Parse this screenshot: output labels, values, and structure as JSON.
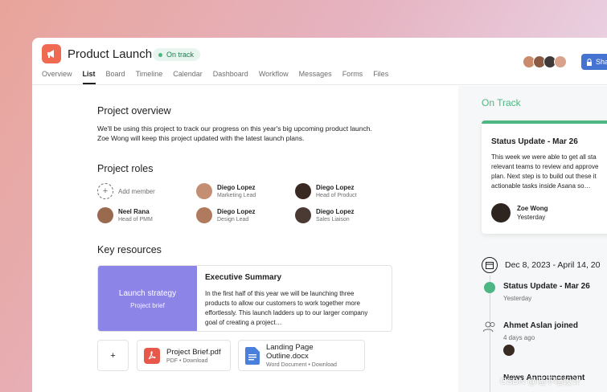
{
  "header": {
    "title": "Product Launch",
    "status": "On track",
    "share_label": "Sha",
    "tabs": [
      "Overview",
      "List",
      "Board",
      "Timeline",
      "Calendar",
      "Dashboard",
      "Workflow",
      "Messages",
      "Forms",
      "Files"
    ],
    "active_tab": "List"
  },
  "overview": {
    "title": "Project overview",
    "line1": "We'll be using this project to track our progress on this year's big upcoming product launch.",
    "line2": "Zoe Wong will keep this project updated with the latest launch plans."
  },
  "roles": {
    "title": "Project roles",
    "add_label": "Add member",
    "members": [
      {
        "name": "Diego Lopez",
        "role": "Marketing Lead"
      },
      {
        "name": "Diego Lopez",
        "role": "Head of Product"
      },
      {
        "name": "Neel Rana",
        "role": "Head of PMM"
      },
      {
        "name": "Diego Lopez",
        "role": "Design Lead"
      },
      {
        "name": "Diego Lopez",
        "role": "Sales Liaison"
      }
    ]
  },
  "resources": {
    "title": "Key resources",
    "thumb_title": "Launch strategy",
    "thumb_subtitle": "Project brief",
    "card_title": "Executive Summary",
    "card_line1": "In the first half of this year we will be launching three",
    "card_line2": "products to allow our customers to work together more",
    "card_line3": "effortlessly. This launch ladders up to our larger company",
    "card_line4": "goal of creating a project…",
    "add_symbol": "+",
    "files": [
      {
        "name": "Project Brief.pdf",
        "meta": "PDF • Download"
      },
      {
        "name": "Landing Page Outline.docx",
        "meta": "Word Document • Download"
      }
    ]
  },
  "sidebar": {
    "status_heading": "On Track",
    "update_title": "Status Update - Mar 26",
    "update_line1": "This week we were able to get all sta",
    "update_line2": "relevant teams to review and approve",
    "update_line3": "plan. Next step is to build out these it",
    "update_line4": "actionable tasks inside Asana so…",
    "author_name": "Zoe Wong",
    "author_time": "Yesterday",
    "date_range": "Dec 8, 2023 - April 14, 20",
    "timeline": [
      {
        "title": "Status Update - Mar 26",
        "sub": "Yesterday"
      },
      {
        "title": "Ahmet Aslan joined",
        "sub": "4 days ago"
      },
      {
        "title": "News Announcement",
        "sub": ""
      }
    ]
  },
  "watermark": "CSDN @喵不喵设计",
  "colors": {
    "accent_green": "#4cb782",
    "brand_orange": "#f06a52",
    "share_blue": "#4573d2",
    "resource_purple": "#8d84e8"
  }
}
